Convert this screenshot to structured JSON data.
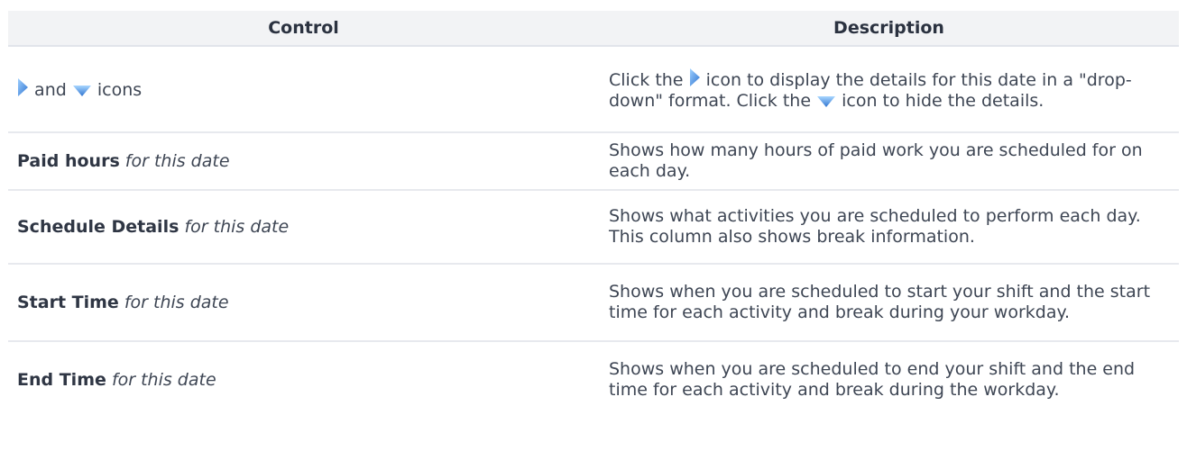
{
  "table": {
    "headers": {
      "control": "Control",
      "description": "Description"
    },
    "row_icons": {
      "control_and": "and",
      "control_icons": "icons",
      "desc_part1": "Click the",
      "desc_part2": "icon to display the details for this date in a \"drop-down\" format. Click the",
      "desc_part3": "icon to hide the details.",
      "expand_icon": "expand-arrow-icon",
      "collapse_icon": "collapse-arrow-icon"
    },
    "rows": [
      {
        "control_bold": "Paid hours",
        "control_italic": "for this date",
        "description": "Shows how many hours of paid work you are scheduled for on each day."
      },
      {
        "control_bold": "Schedule Details",
        "control_italic": "for this date",
        "description": "Shows what activities you are scheduled to perform each day. This column also shows break information."
      },
      {
        "control_bold": "Start Time",
        "control_italic": "for this date",
        "description": "Shows when you are scheduled to start your shift and the start time for each activity and break during your workday."
      },
      {
        "control_bold": "End Time",
        "control_italic": "for this date",
        "description": "Shows when you are scheduled to end your shift and the end time for each activity and break during the workday."
      }
    ]
  },
  "colors": {
    "header_bg": "#f2f3f5",
    "text": "#3e4654",
    "border": "#e7e9ee",
    "icon_blue": "#4a8fe0"
  }
}
